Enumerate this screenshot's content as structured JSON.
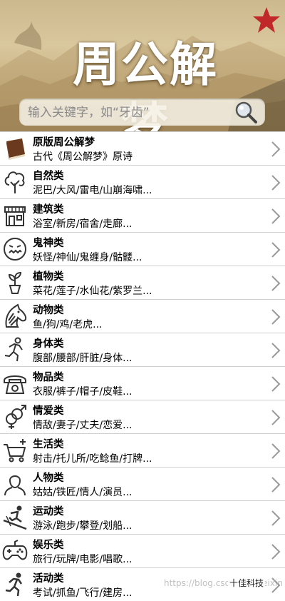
{
  "header": {
    "title": "周公解梦"
  },
  "search": {
    "placeholder": "输入关键字，如“牙齿”"
  },
  "colors": {
    "star": "#c0282a",
    "chevron": "#9a9a9a",
    "separator": "#cfcfcf"
  },
  "items": [
    {
      "icon": "book-icon",
      "title": "原版周公解梦",
      "subtitle": "古代《周公解梦》原诗"
    },
    {
      "icon": "tree-icon",
      "title": "自然类",
      "subtitle": "泥巴/大风/雷电/山崩海啸..."
    },
    {
      "icon": "store-building-icon",
      "title": "建筑类",
      "subtitle": "浴室/新房/宿舍/走廊..."
    },
    {
      "icon": "ghost-face-icon",
      "title": "鬼神类",
      "subtitle": "妖怪/神仙/鬼缠身/骷髅..."
    },
    {
      "icon": "potted-plant-icon",
      "title": "植物类",
      "subtitle": "菜花/莲子/水仙花/紫罗兰..."
    },
    {
      "icon": "horse-head-icon",
      "title": "动物类",
      "subtitle": "鱼/狗/鸡/老虎..."
    },
    {
      "icon": "running-person-icon",
      "title": "身体类",
      "subtitle": "腹部/腰部/肝脏/身体..."
    },
    {
      "icon": "telephone-icon",
      "title": "物品类",
      "subtitle": "衣服/裤子/帽子/皮鞋..."
    },
    {
      "icon": "gender-symbols-icon",
      "title": "情爱类",
      "subtitle": "情敌/妻子/丈夫/恋爱..."
    },
    {
      "icon": "shopping-cart-icon",
      "title": "生活类",
      "subtitle": "射击/托儿所/吃鲶鱼/打牌..."
    },
    {
      "icon": "person-bust-icon",
      "title": "人物类",
      "subtitle": "姑姑/铁匠/情人/演员..."
    },
    {
      "icon": "skier-icon",
      "title": "运动类",
      "subtitle": "游泳/跑步/攀登/划船..."
    },
    {
      "icon": "gamepad-icon",
      "title": "娱乐类",
      "subtitle": "旅行/玩牌/电影/唱歌..."
    },
    {
      "icon": "runner-icon",
      "title": "活动类",
      "subtitle": "考试/抓鱼/飞行/建房..."
    }
  ],
  "watermark": {
    "url": "https://blog.csdn.net/weixin",
    "brand": "十佳科技"
  }
}
